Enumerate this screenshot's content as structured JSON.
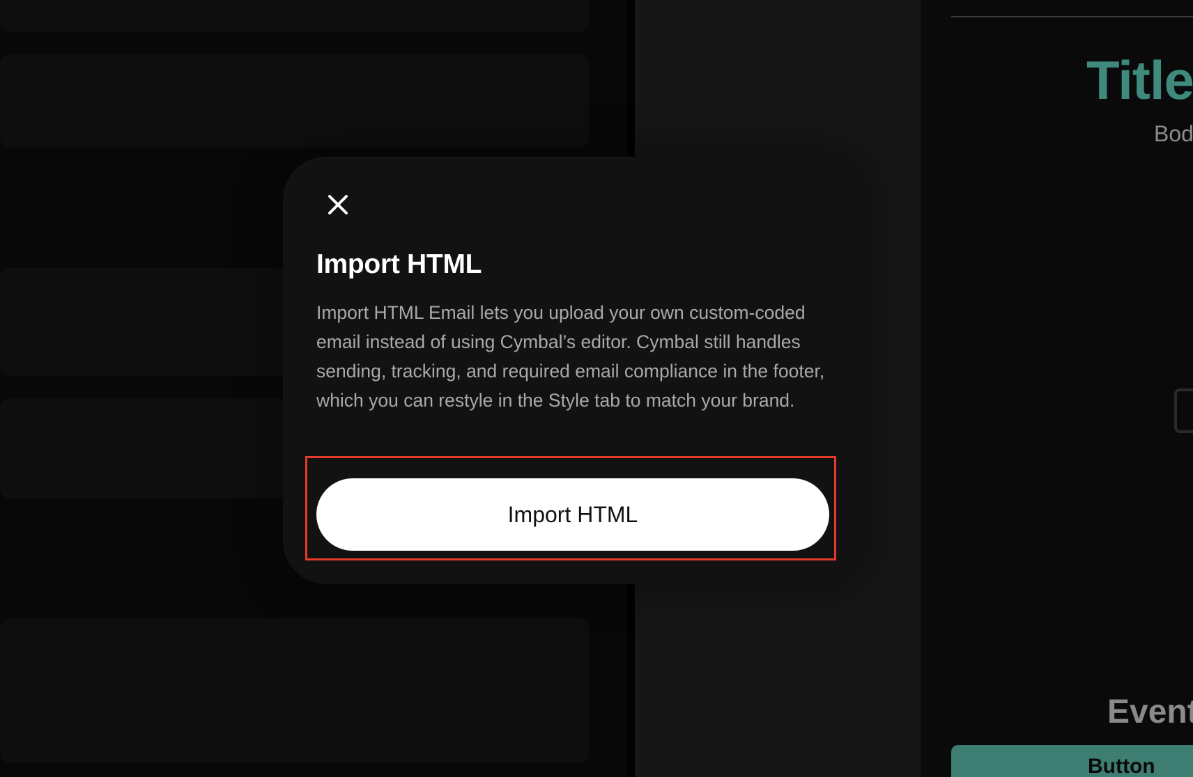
{
  "modal": {
    "close_icon": "close-icon",
    "title": "Import HTML",
    "description": "Import HTML Email lets you upload your own custom-coded email instead of using Cymbal’s editor. Cymbal still handles sending, tracking, and required email compliance in the footer, which you can restyle in the Style tab to match your brand.",
    "primary_button_label": "Import HTML",
    "highlight_color": "#e53b2a"
  },
  "preview": {
    "title": "Title",
    "body": "Body",
    "image_icon": "image-icon",
    "event_heading": "Event",
    "button_label": "Button",
    "accent_color": "#3f8a7c"
  }
}
